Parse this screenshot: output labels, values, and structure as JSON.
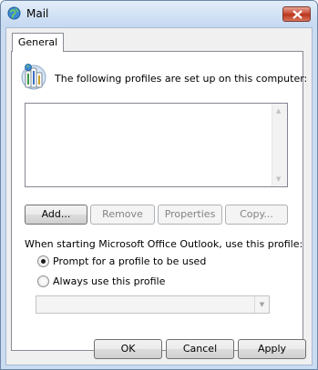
{
  "window": {
    "title": "Mail",
    "icon": "mail-globe-icon"
  },
  "tabs": [
    {
      "label": "General",
      "selected": true
    }
  ],
  "profiles": {
    "intro_text": "The following profiles are set up on this computer:",
    "items": []
  },
  "profile_buttons": {
    "add": "Add...",
    "remove": "Remove",
    "properties": "Properties",
    "copy": "Copy..."
  },
  "startup": {
    "label": "When starting Microsoft Office Outlook, use this profile:",
    "prompt_option": "Prompt for a profile to be used",
    "always_option": "Always use this profile",
    "selected_option": "prompt",
    "always_profile_value": ""
  },
  "dialog_buttons": {
    "ok": "OK",
    "cancel": "Cancel",
    "apply": "Apply"
  },
  "colors": {
    "close_button": "#c5442f",
    "title_bar": "#c5d9f1",
    "dialog_face": "#f0f0f0"
  }
}
